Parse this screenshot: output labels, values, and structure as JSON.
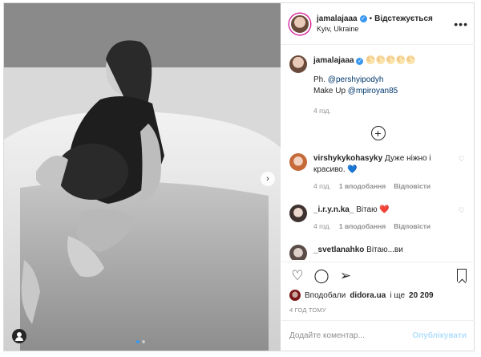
{
  "post": {
    "username": "jamalajaaa",
    "follow_label": "Відстежується",
    "location": "Kyiv, Ukraine",
    "more_label": "•••"
  },
  "caption": {
    "username": "jamalajaaa",
    "emojis": "🌕🌕🌕🌕🌕",
    "ph_prefix": "Ph.",
    "ph_mention": "@pershyipodyh",
    "makeup_prefix": "Make Up",
    "makeup_mention": "@mpiroyan85",
    "time": "4 год."
  },
  "load_more_label": "+",
  "comments": [
    {
      "username": "virshykykohasyky",
      "text": "Дуже ніжно і красиво.",
      "emoji": "💙",
      "time": "4 год.",
      "likes": "1 вподобання",
      "reply": "Відповісти"
    },
    {
      "username": "_i.r.y.n.ka_",
      "text": "Вітаю",
      "emoji": "❤️",
      "time": "4 год.",
      "likes": "1 вподобання",
      "reply": "Відповісти"
    },
    {
      "username": "_svetlanahko",
      "text": "Вітаю...ви",
      "emoji": "",
      "time": "",
      "likes": "",
      "reply": ""
    }
  ],
  "actions": {
    "like_icon": "heart-icon",
    "comment_icon": "comment-icon",
    "share_icon": "share-icon",
    "save_icon": "bookmark-icon"
  },
  "likes": {
    "prefix": "Вподобали",
    "user": "didora.ua",
    "and": "і ще",
    "count": "20 209"
  },
  "posted_ago": "4 ГОД ТОМУ",
  "add_comment": {
    "placeholder": "Додайте коментар...",
    "publish_label": "Опублікувати"
  },
  "photo": {
    "next_icon": "chevron-right-icon",
    "tag_icon": "user-tag-icon",
    "carousel_dots": 2,
    "active_dot": 1
  },
  "colors": {
    "verified": "#3897f0",
    "link": "#00376b",
    "publish": "#b2dffc",
    "muted": "#8e8e8e"
  }
}
